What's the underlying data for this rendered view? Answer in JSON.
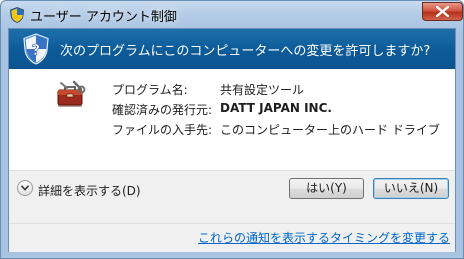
{
  "window": {
    "title": "ユーザー アカウント制御"
  },
  "banner": {
    "question": "次のプログラムにこのコンピューターへの変更を許可しますか?"
  },
  "details": {
    "program_label": "プログラム名:",
    "program_value": "共有設定ツール",
    "publisher_label": "確認済みの発行元:",
    "publisher_value": "DATT JAPAN INC.",
    "origin_label": "ファイルの入手先:",
    "origin_value": "このコンピューター上のハード ドライブ"
  },
  "footer": {
    "show_details_label": "詳細を表示する(D)",
    "yes_label": "はい(Y)",
    "no_label": "いいえ(N)",
    "notify_link": "これらの通知を表示するタイミングを変更する"
  },
  "colors": {
    "banner": "#0c5a98",
    "link": "#0066cc",
    "close_button": "#c74a32"
  }
}
